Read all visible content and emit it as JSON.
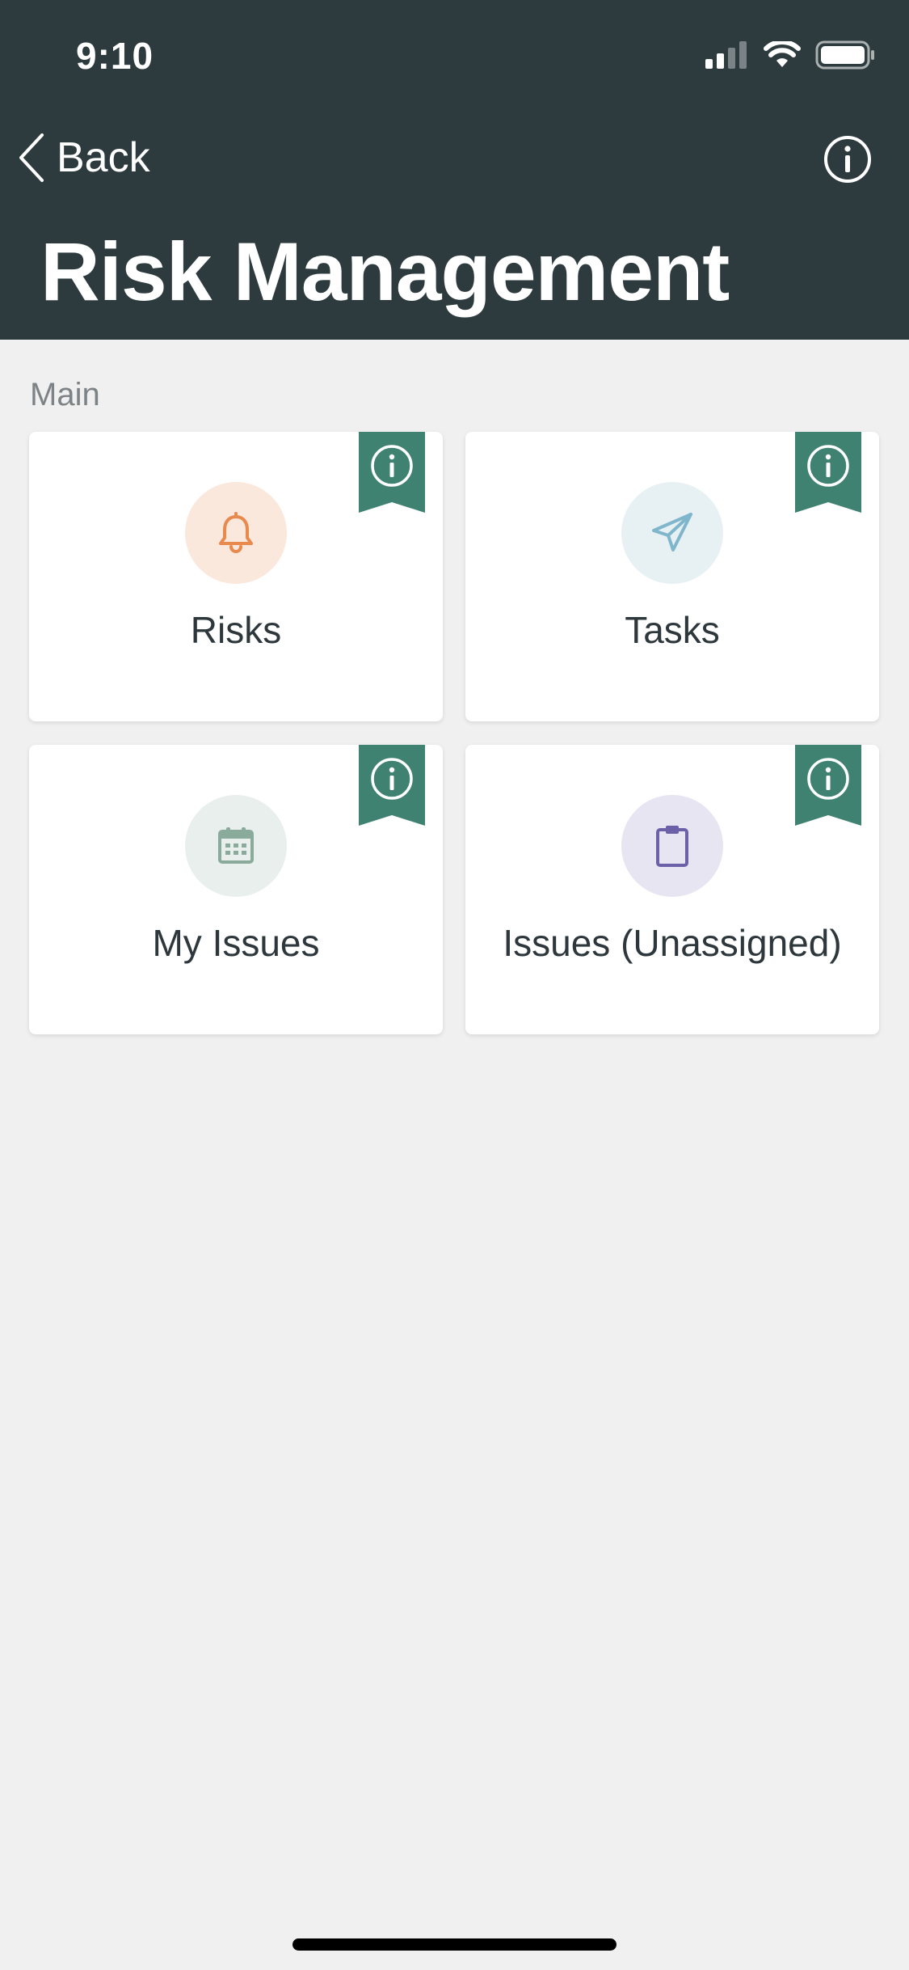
{
  "status_bar": {
    "time": "9:10"
  },
  "nav": {
    "back_label": "Back",
    "title": "Risk Management"
  },
  "section": {
    "label": "Main"
  },
  "cards": [
    {
      "label": "Risks",
      "icon": "bell-icon",
      "icon_color": "#e8894e",
      "circle_color": "#fbe8dc"
    },
    {
      "label": "Tasks",
      "icon": "paper-plane-icon",
      "icon_color": "#7fb6cc",
      "circle_color": "#e7f1f4"
    },
    {
      "label": "My Issues",
      "icon": "calendar-icon",
      "icon_color": "#8aab9c",
      "circle_color": "#e9efec"
    },
    {
      "label": "Issues (Unassigned)",
      "icon": "clipboard-icon",
      "icon_color": "#6c61a8",
      "circle_color": "#e7e5f1"
    }
  ],
  "colors": {
    "header_bg": "#2d3b3e",
    "ribbon": "#3f8272",
    "page_bg": "#f0f0f0"
  }
}
